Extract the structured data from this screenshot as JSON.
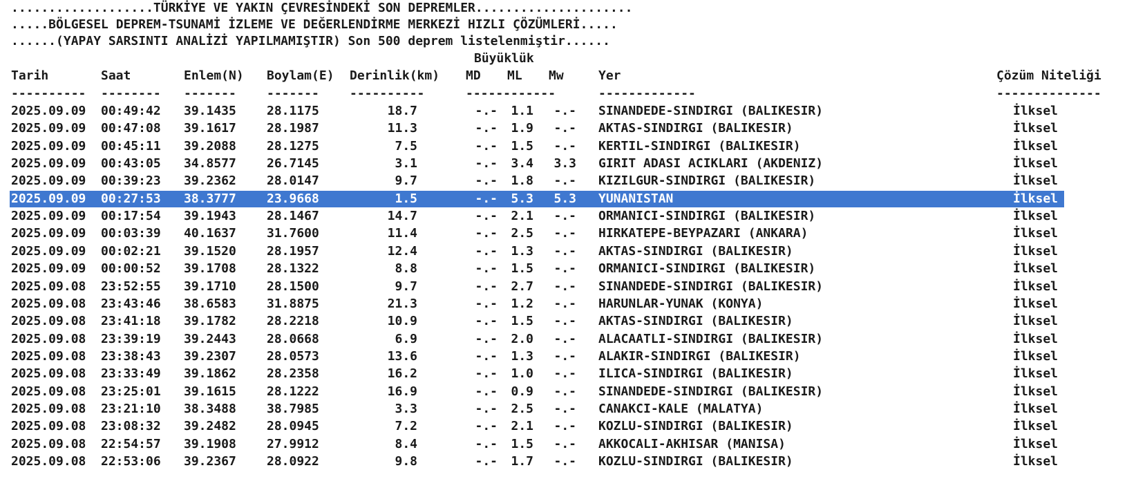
{
  "header": {
    "line1": "...................TÜRKİYE VE YAKIN ÇEVRESİNDEKİ SON DEPREMLER.....................",
    "line2": ".....BÖLGESEL DEPREM-TSUNAMİ İZLEME VE DEĞERLENDİRME MERKEZİ HIZLI ÇÖZÜMLERİ.....",
    "line3": "......(YAPAY SARSINTI ANALİZİ YAPILMAMIŞTIR) Son 500 deprem listelenmiştir......"
  },
  "table": {
    "group_header": "Büyüklük",
    "columns": [
      "Tarih",
      "Saat",
      "Enlem(N)",
      "Boylam(E)",
      "Derinlik(km)",
      "MD",
      "ML",
      "Mw",
      "Yer",
      "Çözüm Niteliği"
    ],
    "dashes": [
      "----------",
      "--------",
      "-------",
      "-------",
      "----------",
      "------------",
      "-------------",
      "--------------"
    ],
    "selected_index": 5,
    "rows": [
      {
        "date": "2025.09.09",
        "time": "00:49:42",
        "lat": "39.1435",
        "lon": "28.1175",
        "depth": "18.7",
        "md": "-.-",
        "ml": "1.1",
        "mw": "-.-",
        "place": "SINANDEDE-SINDIRGI (BALIKESIR)",
        "quality": "İlksel"
      },
      {
        "date": "2025.09.09",
        "time": "00:47:08",
        "lat": "39.1617",
        "lon": "28.1987",
        "depth": "11.3",
        "md": "-.-",
        "ml": "1.9",
        "mw": "-.-",
        "place": "AKTAS-SINDIRGI (BALIKESIR)",
        "quality": "İlksel"
      },
      {
        "date": "2025.09.09",
        "time": "00:45:11",
        "lat": "39.2088",
        "lon": "28.1275",
        "depth": "7.5",
        "md": "-.-",
        "ml": "1.5",
        "mw": "-.-",
        "place": "KERTIL-SINDIRGI (BALIKESIR)",
        "quality": "İlksel"
      },
      {
        "date": "2025.09.09",
        "time": "00:43:05",
        "lat": "34.8577",
        "lon": "26.7145",
        "depth": "3.1",
        "md": "-.-",
        "ml": "3.4",
        "mw": "3.3",
        "place": "GIRIT ADASI ACIKLARI (AKDENIZ)",
        "quality": "İlksel"
      },
      {
        "date": "2025.09.09",
        "time": "00:39:23",
        "lat": "39.2362",
        "lon": "28.0147",
        "depth": "9.7",
        "md": "-.-",
        "ml": "1.8",
        "mw": "-.-",
        "place": "KIZILGUR-SINDIRGI (BALIKESIR)",
        "quality": "İlksel"
      },
      {
        "date": "2025.09.09",
        "time": "00:27:53",
        "lat": "38.3777",
        "lon": "23.9668",
        "depth": "1.5",
        "md": "-.-",
        "ml": "5.3",
        "mw": "5.3",
        "place": "YUNANISTAN",
        "quality": "İlksel"
      },
      {
        "date": "2025.09.09",
        "time": "00:17:54",
        "lat": "39.1943",
        "lon": "28.1467",
        "depth": "14.7",
        "md": "-.-",
        "ml": "2.1",
        "mw": "-.-",
        "place": "ORMANICI-SINDIRGI (BALIKESIR)",
        "quality": "İlksel"
      },
      {
        "date": "2025.09.09",
        "time": "00:03:39",
        "lat": "40.1637",
        "lon": "31.7600",
        "depth": "11.4",
        "md": "-.-",
        "ml": "2.5",
        "mw": "-.-",
        "place": "HIRKATEPE-BEYPAZARI (ANKARA)",
        "quality": "İlksel"
      },
      {
        "date": "2025.09.09",
        "time": "00:02:21",
        "lat": "39.1520",
        "lon": "28.1957",
        "depth": "12.4",
        "md": "-.-",
        "ml": "1.3",
        "mw": "-.-",
        "place": "AKTAS-SINDIRGI (BALIKESIR)",
        "quality": "İlksel"
      },
      {
        "date": "2025.09.09",
        "time": "00:00:52",
        "lat": "39.1708",
        "lon": "28.1322",
        "depth": "8.8",
        "md": "-.-",
        "ml": "1.5",
        "mw": "-.-",
        "place": "ORMANICI-SINDIRGI (BALIKESIR)",
        "quality": "İlksel"
      },
      {
        "date": "2025.09.08",
        "time": "23:52:55",
        "lat": "39.1710",
        "lon": "28.1500",
        "depth": "9.7",
        "md": "-.-",
        "ml": "2.7",
        "mw": "-.-",
        "place": "SINANDEDE-SINDIRGI (BALIKESIR)",
        "quality": "İlksel"
      },
      {
        "date": "2025.09.08",
        "time": "23:43:46",
        "lat": "38.6583",
        "lon": "31.8875",
        "depth": "21.3",
        "md": "-.-",
        "ml": "1.2",
        "mw": "-.-",
        "place": "HARUNLAR-YUNAK (KONYA)",
        "quality": "İlksel"
      },
      {
        "date": "2025.09.08",
        "time": "23:41:18",
        "lat": "39.1782",
        "lon": "28.2218",
        "depth": "10.9",
        "md": "-.-",
        "ml": "1.5",
        "mw": "-.-",
        "place": "AKTAS-SINDIRGI (BALIKESIR)",
        "quality": "İlksel"
      },
      {
        "date": "2025.09.08",
        "time": "23:39:19",
        "lat": "39.2443",
        "lon": "28.0668",
        "depth": "6.9",
        "md": "-.-",
        "ml": "2.0",
        "mw": "-.-",
        "place": "ALACAATLI-SINDIRGI (BALIKESIR)",
        "quality": "İlksel"
      },
      {
        "date": "2025.09.08",
        "time": "23:38:43",
        "lat": "39.2307",
        "lon": "28.0573",
        "depth": "13.6",
        "md": "-.-",
        "ml": "1.3",
        "mw": "-.-",
        "place": "ALAKIR-SINDIRGI (BALIKESIR)",
        "quality": "İlksel"
      },
      {
        "date": "2025.09.08",
        "time": "23:33:49",
        "lat": "39.1862",
        "lon": "28.2358",
        "depth": "16.2",
        "md": "-.-",
        "ml": "1.0",
        "mw": "-.-",
        "place": "ILICA-SINDIRGI (BALIKESIR)",
        "quality": "İlksel"
      },
      {
        "date": "2025.09.08",
        "time": "23:25:01",
        "lat": "39.1615",
        "lon": "28.1222",
        "depth": "16.9",
        "md": "-.-",
        "ml": "0.9",
        "mw": "-.-",
        "place": "SINANDEDE-SINDIRGI (BALIKESIR)",
        "quality": "İlksel"
      },
      {
        "date": "2025.09.08",
        "time": "23:21:10",
        "lat": "38.3488",
        "lon": "38.7985",
        "depth": "3.3",
        "md": "-.-",
        "ml": "2.5",
        "mw": "-.-",
        "place": "CANAKCI-KALE (MALATYA)",
        "quality": "İlksel"
      },
      {
        "date": "2025.09.08",
        "time": "23:08:32",
        "lat": "39.2482",
        "lon": "28.0945",
        "depth": "7.2",
        "md": "-.-",
        "ml": "2.1",
        "mw": "-.-",
        "place": "KOZLU-SINDIRGI (BALIKESIR)",
        "quality": "İlksel"
      },
      {
        "date": "2025.09.08",
        "time": "22:54:57",
        "lat": "39.1908",
        "lon": "27.9912",
        "depth": "8.4",
        "md": "-.-",
        "ml": "1.5",
        "mw": "-.-",
        "place": "AKKOCALI-AKHISAR (MANISA)",
        "quality": "İlksel"
      },
      {
        "date": "2025.09.08",
        "time": "22:53:06",
        "lat": "39.2367",
        "lon": "28.0922",
        "depth": "9.8",
        "md": "-.-",
        "ml": "1.7",
        "mw": "-.-",
        "place": "KOZLU-SINDIRGI (BALIKESIR)",
        "quality": "İlksel"
      }
    ]
  }
}
